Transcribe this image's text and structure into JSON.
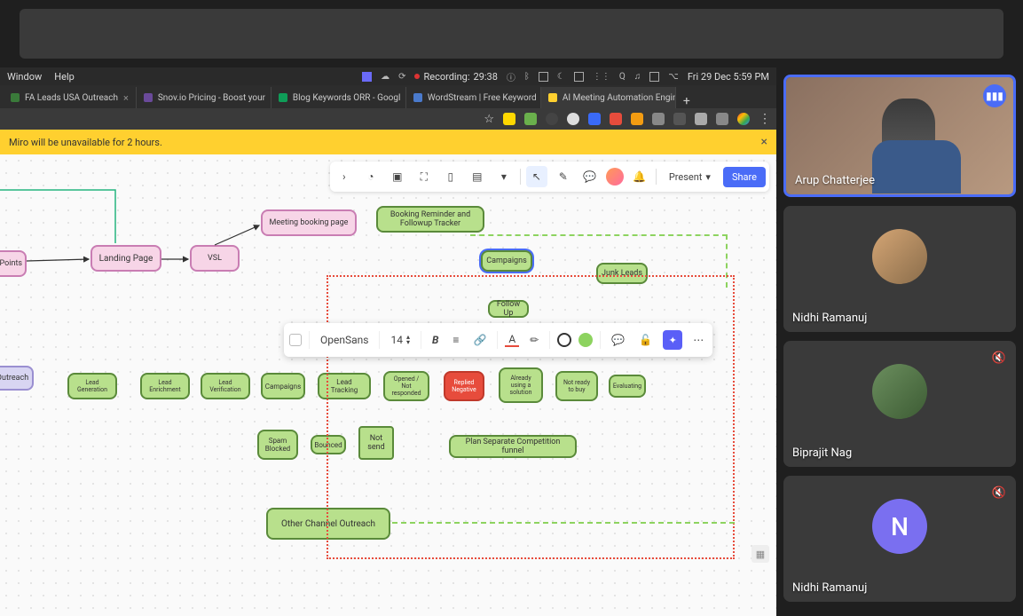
{
  "topbar": {},
  "mac_menu": {
    "window": "Window",
    "help": "Help",
    "recording_label": "Recording:",
    "recording_time": "29:38",
    "datetime": "Fri 29 Dec  5:59 PM"
  },
  "tabs": [
    {
      "label": "FA Leads USA Outreach",
      "fav": "#3a7a3a"
    },
    {
      "label": "Snov.io Pricing - Boost your",
      "fav": "#6a4a9a"
    },
    {
      "label": "Blog Keywords ORR - Googl",
      "fav": "#0f9d58"
    },
    {
      "label": "WordStream | Free Keyword",
      "fav": "#4a7acc"
    },
    {
      "label": "AI Meeting Automation Engin",
      "fav": "#ffd02f",
      "active": true
    }
  ],
  "extensions": {
    "colors": [
      "#ffd800",
      "#6ab04c",
      "#f39c12",
      "#ddd",
      "#ddd",
      "#ddd",
      "#e67e22",
      "#c0392b",
      "#f1c40f",
      "#ddd",
      "#ddd",
      "#ddd"
    ]
  },
  "banner": {
    "text": "Miro will be unavailable for 2 hours."
  },
  "miro_toolbar": {
    "present": "Present",
    "share": "Share"
  },
  "float_toolbar": {
    "font": "OpenSans",
    "size": "14"
  },
  "nodes": {
    "touchpoints": "achPoints",
    "landing_page": "Landing Page",
    "vsl": "VSL",
    "meeting_booking": "Meeting booking page",
    "booking_reminder": "Booking Reminder and Followup Tracker",
    "campaigns_top": "Campaigns",
    "junk_leads": "Junk Leads",
    "followup": "Follow Up",
    "outreach": "Outreach",
    "lead_gen": "Lead Generation",
    "lead_enrich": "Lead Enrichment",
    "lead_verif": "Lead Verification",
    "campaigns": "Campaigns",
    "lead_tracking": "Lead Tracking",
    "opened_not": "Opened / Not responded",
    "replied_neg": "Replied Negative",
    "already_using": "Already using a solution",
    "not_ready": "Not ready to buy",
    "evaluating": "Evaluating",
    "spam_blocked": "Spam Blocked",
    "bounced": "Bounced",
    "not_send": "Not send",
    "plan_sep": "Plan Separate Competition funnel",
    "other_channel": "Other Channel Outreach"
  },
  "participants": [
    {
      "name": "Arup Chatterjee",
      "speaking": true,
      "video": true
    },
    {
      "name": "Nidhi Ramanuj",
      "avatar": "photo"
    },
    {
      "name": "Biprajit Nag",
      "avatar": "photo2",
      "muted": true
    },
    {
      "name": "Nidhi Ramanuj",
      "avatar": "initial",
      "initial": "N",
      "muted": true
    }
  ]
}
